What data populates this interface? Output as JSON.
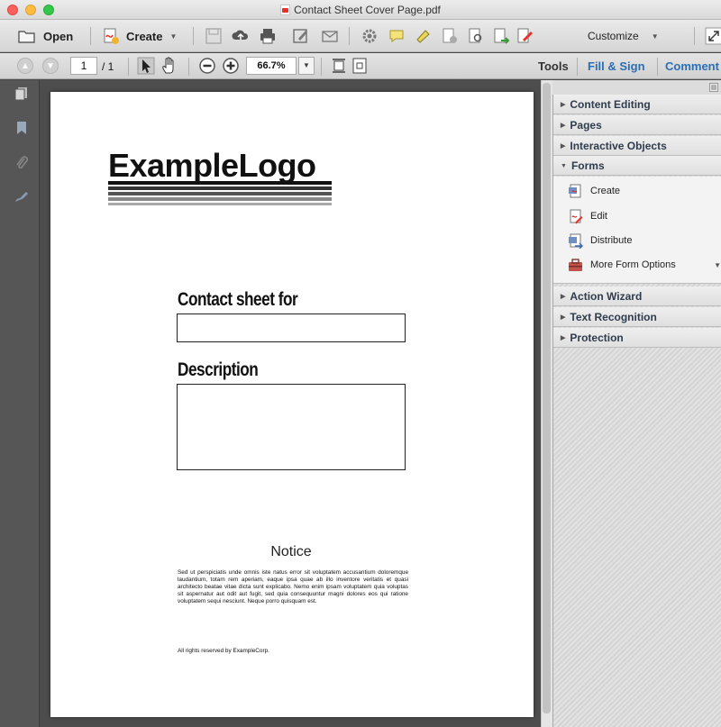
{
  "window": {
    "title": "Contact Sheet Cover Page.pdf"
  },
  "toolbar": {
    "open_label": "Open",
    "create_label": "Create",
    "customize_label": "Customize"
  },
  "nav": {
    "page_current": "1",
    "page_total": "/ 1",
    "zoom": "66.7%"
  },
  "panel_links": {
    "tools": "Tools",
    "fill_sign": "Fill & Sign",
    "comment": "Comment"
  },
  "document": {
    "logo": "ExampleLogo",
    "contact_label": "Contact sheet for",
    "contact_value": "",
    "description_label": "Description",
    "description_value": "",
    "notice_title": "Notice",
    "notice_body": "Sed ut perspiciatis unde omnis iste natus error sit voluptatem accusantium doloremque laudantium, totam rem aperiam, eaque ipsa quae ab illo inventore veritatis et quasi architecto beatae vitae dicta sunt explicabo. Nemo enim ipsam voluptatem quia voluptas sit aspernatur aut odit aut fugit, sed quia consequuntur magni dolores eos qui ratione voluptatem sequi nesciunt. Neque porro quisquam est.",
    "rights": "All rights reserved by ExampleCorp."
  },
  "right_pane": {
    "sections_top": [
      "Content Editing",
      "Pages",
      "Interactive Objects"
    ],
    "forms_label": "Forms",
    "forms_items": [
      "Create",
      "Edit",
      "Distribute",
      "More Form Options"
    ],
    "sections_bottom": [
      "Action Wizard",
      "Text Recognition",
      "Protection"
    ]
  },
  "colors": {
    "link_blue": "#2a6fb5",
    "pdf_red": "#e4322b",
    "section_text": "#2f3c4d"
  }
}
